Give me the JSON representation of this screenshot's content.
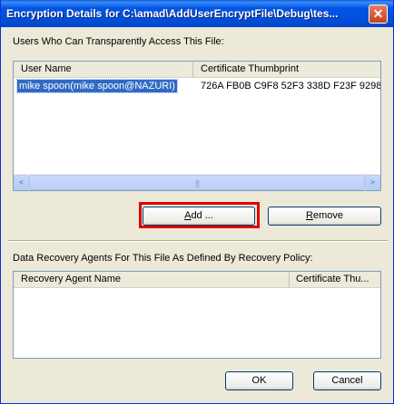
{
  "window": {
    "title": "Encryption Details for C:\\amad\\AddUserEncryptFile\\Debug\\tes...",
    "close_glyph": "✕"
  },
  "users_section": {
    "label": "Users Who Can Transparently Access This File:",
    "columns": [
      "User Name",
      "Certificate Thumbprint"
    ],
    "rows": [
      {
        "user_name": "mike spoon(mike spoon@NAZURI)",
        "thumbprint": "726A FB0B C9F8 52F3 338D F23F 9298 ..."
      }
    ],
    "scrollbar": {
      "left_glyph": "<",
      "right_glyph": ">",
      "thumb_grip": "|||"
    }
  },
  "buttons": {
    "add": {
      "prefix": "",
      "mnemonic": "A",
      "suffix": "dd ..."
    },
    "remove": {
      "prefix": "",
      "mnemonic": "R",
      "suffix": "emove"
    },
    "ok": "OK",
    "cancel": "Cancel"
  },
  "recovery_section": {
    "label": "Data Recovery Agents For This File As Defined By Recovery Policy:",
    "columns": [
      "Recovery Agent Name",
      "Certificate Thu..."
    ]
  },
  "colors": {
    "titlebar": "#0055E5",
    "selection": "#316AC5",
    "highlight_box": "#E00000",
    "dialog_bg": "#ECE9D8"
  }
}
